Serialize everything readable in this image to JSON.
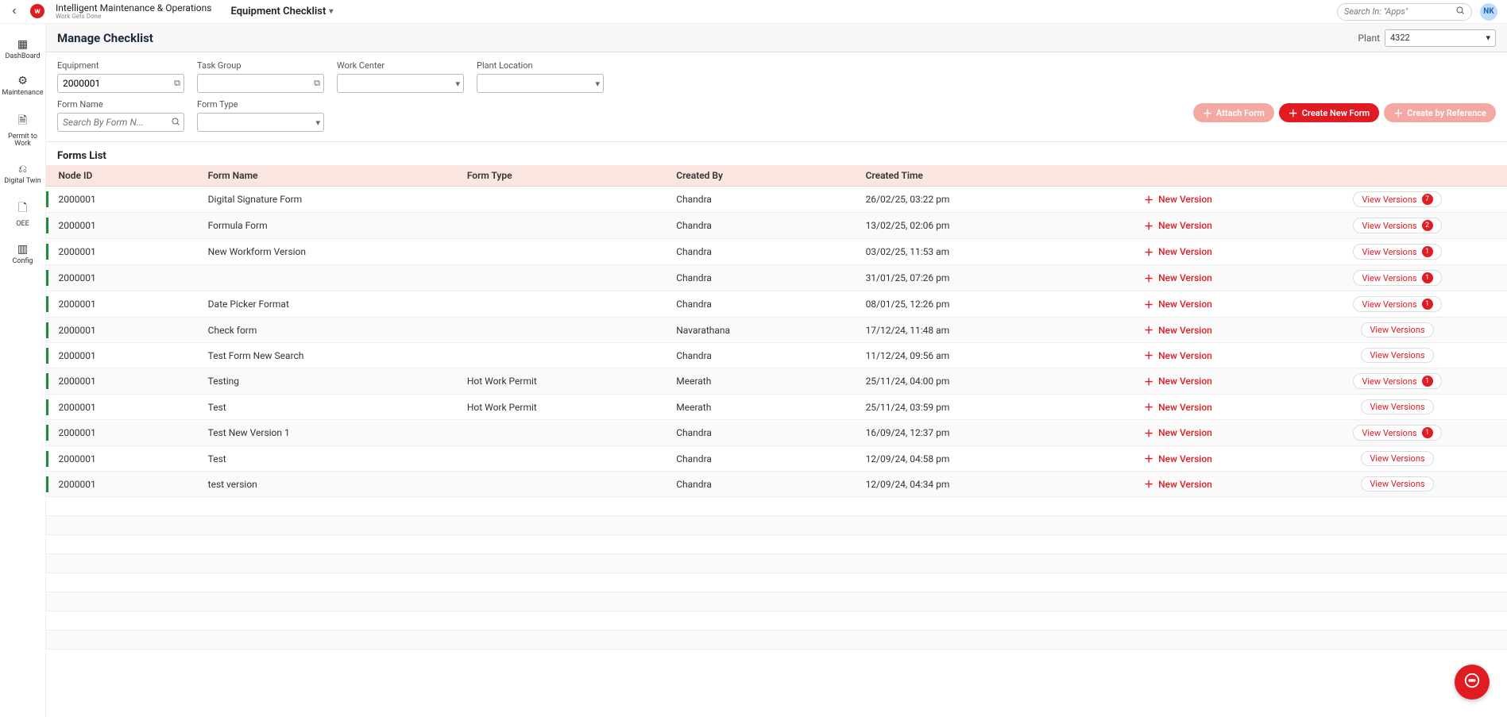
{
  "header": {
    "app_title": "Intelligent Maintenance & Operations",
    "app_subtitle": "Work Gets Done",
    "breadcrumb": "Equipment Checklist",
    "search_placeholder": "Search In: \"Apps\"",
    "avatar": "NK"
  },
  "sidebar": {
    "items": [
      {
        "label": "DashBoard"
      },
      {
        "label": "Maintenance"
      },
      {
        "label": "Permit to Work"
      },
      {
        "label": "Digital Twin"
      },
      {
        "label": "OEE"
      },
      {
        "label": "Config"
      }
    ]
  },
  "page": {
    "title": "Manage Checklist",
    "plant_label": "Plant",
    "plant_value": "4322"
  },
  "filters": {
    "equipment_label": "Equipment",
    "equipment_value": "2000001",
    "task_group_label": "Task Group",
    "task_group_value": "",
    "work_center_label": "Work Center",
    "work_center_value": "",
    "plant_location_label": "Plant Location",
    "plant_location_value": "",
    "form_name_label": "Form Name",
    "form_name_placeholder": "Search By Form N...",
    "form_type_label": "Form Type",
    "form_type_value": ""
  },
  "actions": {
    "attach": "Attach Form",
    "create": "Create New Form",
    "create_ref": "Create by Reference"
  },
  "list_title": "Forms List",
  "table": {
    "headers": {
      "node_id": "Node ID",
      "form_name": "Form Name",
      "form_type": "Form Type",
      "created_by": "Created By",
      "created_time": "Created Time"
    },
    "new_version_label": "New Version",
    "view_versions_label": "View Versions",
    "rows": [
      {
        "node_id": "2000001",
        "form_name": "Digital Signature Form",
        "form_type": "",
        "created_by": "Chandra",
        "created_time": "26/02/25, 03:22 pm",
        "badge": "7"
      },
      {
        "node_id": "2000001",
        "form_name": "Formula Form",
        "form_type": "",
        "created_by": "Chandra",
        "created_time": "13/02/25, 02:06 pm",
        "badge": "2"
      },
      {
        "node_id": "2000001",
        "form_name": "New Workform Version",
        "form_type": "",
        "created_by": "Chandra",
        "created_time": "03/02/25, 11:53 am",
        "badge": "1"
      },
      {
        "node_id": "2000001",
        "form_name": "",
        "form_type": "",
        "created_by": "Chandra",
        "created_time": "31/01/25, 07:26 pm",
        "badge": "1"
      },
      {
        "node_id": "2000001",
        "form_name": "Date Picker Format",
        "form_type": "",
        "created_by": "Chandra",
        "created_time": "08/01/25, 12:26 pm",
        "badge": "1"
      },
      {
        "node_id": "2000001",
        "form_name": "Check form",
        "form_type": "",
        "created_by": "Navarathana",
        "created_time": "17/12/24, 11:48 am",
        "badge": ""
      },
      {
        "node_id": "2000001",
        "form_name": "Test Form New Search",
        "form_type": "",
        "created_by": "Chandra",
        "created_time": "11/12/24, 09:56 am",
        "badge": ""
      },
      {
        "node_id": "2000001",
        "form_name": "Testing",
        "form_type": "Hot Work Permit",
        "created_by": "Meerath",
        "created_time": "25/11/24, 04:00 pm",
        "badge": "1"
      },
      {
        "node_id": "2000001",
        "form_name": "Test",
        "form_type": "Hot Work Permit",
        "created_by": "Meerath",
        "created_time": "25/11/24, 03:59 pm",
        "badge": ""
      },
      {
        "node_id": "2000001",
        "form_name": "Test New Version 1",
        "form_type": "",
        "created_by": "Chandra",
        "created_time": "16/09/24, 12:37 pm",
        "badge": "1"
      },
      {
        "node_id": "2000001",
        "form_name": "Test",
        "form_type": "",
        "created_by": "Chandra",
        "created_time": "12/09/24, 04:58 pm",
        "badge": ""
      },
      {
        "node_id": "2000001",
        "form_name": "test version",
        "form_type": "",
        "created_by": "Chandra",
        "created_time": "12/09/24, 04:34 pm",
        "badge": ""
      }
    ],
    "empty_rows": 8
  }
}
